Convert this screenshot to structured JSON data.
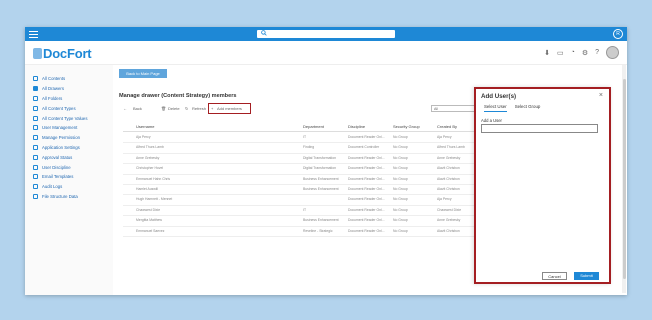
{
  "app": {
    "name": "DocFort",
    "logo_initial": "D",
    "user_initial": "R"
  },
  "search": {
    "placeholder": ""
  },
  "colors": {
    "accent": "#1e88d6",
    "highlight": "#a41e22",
    "background": "#b3d3ed"
  },
  "sidebar": {
    "items": [
      {
        "label": "All Contents",
        "icon": "contents-icon"
      },
      {
        "label": "All Drawers",
        "icon": "drawer-icon",
        "active": true
      },
      {
        "label": "All Folders",
        "icon": "folder-icon"
      },
      {
        "label": "All Content Types",
        "icon": "content-type-icon"
      },
      {
        "label": "All Content Type Values",
        "icon": "content-type-values-icon"
      },
      {
        "label": "User Management",
        "icon": "user-icon"
      },
      {
        "label": "Manage Permission",
        "icon": "permission-icon"
      },
      {
        "label": "Application Settings",
        "icon": "settings-icon"
      },
      {
        "label": "Approval Status",
        "icon": "approval-icon"
      },
      {
        "label": "User Discipline",
        "icon": "discipline-icon"
      },
      {
        "label": "Email Templates",
        "icon": "email-icon"
      },
      {
        "label": "Audit Logs",
        "icon": "audit-icon"
      },
      {
        "label": "File Structure Data",
        "icon": "file-structure-icon"
      }
    ]
  },
  "main": {
    "back_label": "Back to Main Page",
    "title": "Manage drawer (Content Strategy) members",
    "toolbar": {
      "back": "Back",
      "delete": "Delete",
      "refresh": "Refresh",
      "add": "Add members"
    },
    "filter_value": "All",
    "columns": [
      "Username",
      "Department",
      "Discipline",
      "Security Group",
      "Created By"
    ],
    "rows": [
      [
        "Aja Percy",
        "IT",
        "Document Reader Onl...",
        "No Group",
        "Aja Percy"
      ],
      [
        "Alfred Thurs Lamb",
        "Finding",
        "Document Controller",
        "No Group",
        "Alfred Thurs Lamb"
      ],
      [
        "Anne Grebesky",
        "Digital Transformation",
        "Document Reader Onl...",
        "No Group",
        "Anne Grebesky"
      ],
      [
        "Christopher Hovel",
        "Digital Transformation",
        "Document Reader Onl...",
        "No Group",
        "Alavit Chrisbon"
      ],
      [
        "Emmanuel Hahn Chris",
        "Business Enhancement",
        "Document Reader Onl...",
        "No Group",
        "Alavit Chrisbon"
      ],
      [
        "Hamlet Auswill",
        "Business Enhancement",
        "Document Reader Onl...",
        "No Group",
        "Alavit Chrisbon"
      ],
      [
        "Hugh Hamnett - Mennet",
        "",
        "Document Reader Onl...",
        "No Group",
        "Aja Percy"
      ],
      [
        "Chawwest Dixie",
        "IT",
        "Document Reader Onl...",
        "No Group",
        "Chawwest Dixie"
      ],
      [
        "Mergitta Matthew",
        "Business Enhancement",
        "Document Reader Onl...",
        "No Group",
        "Anne Grebesky"
      ],
      [
        "Emmanuel Saevez",
        "Reveline - Strategic",
        "Document Reader Onl...",
        "No Group",
        "Alavit Chrisbon"
      ]
    ]
  },
  "panel": {
    "title": "Add User(s)",
    "tabs": [
      "Select User",
      "Select Group"
    ],
    "field_label": "Add a User",
    "field_value": "",
    "cancel": "Cancel",
    "submit": "Submit"
  }
}
